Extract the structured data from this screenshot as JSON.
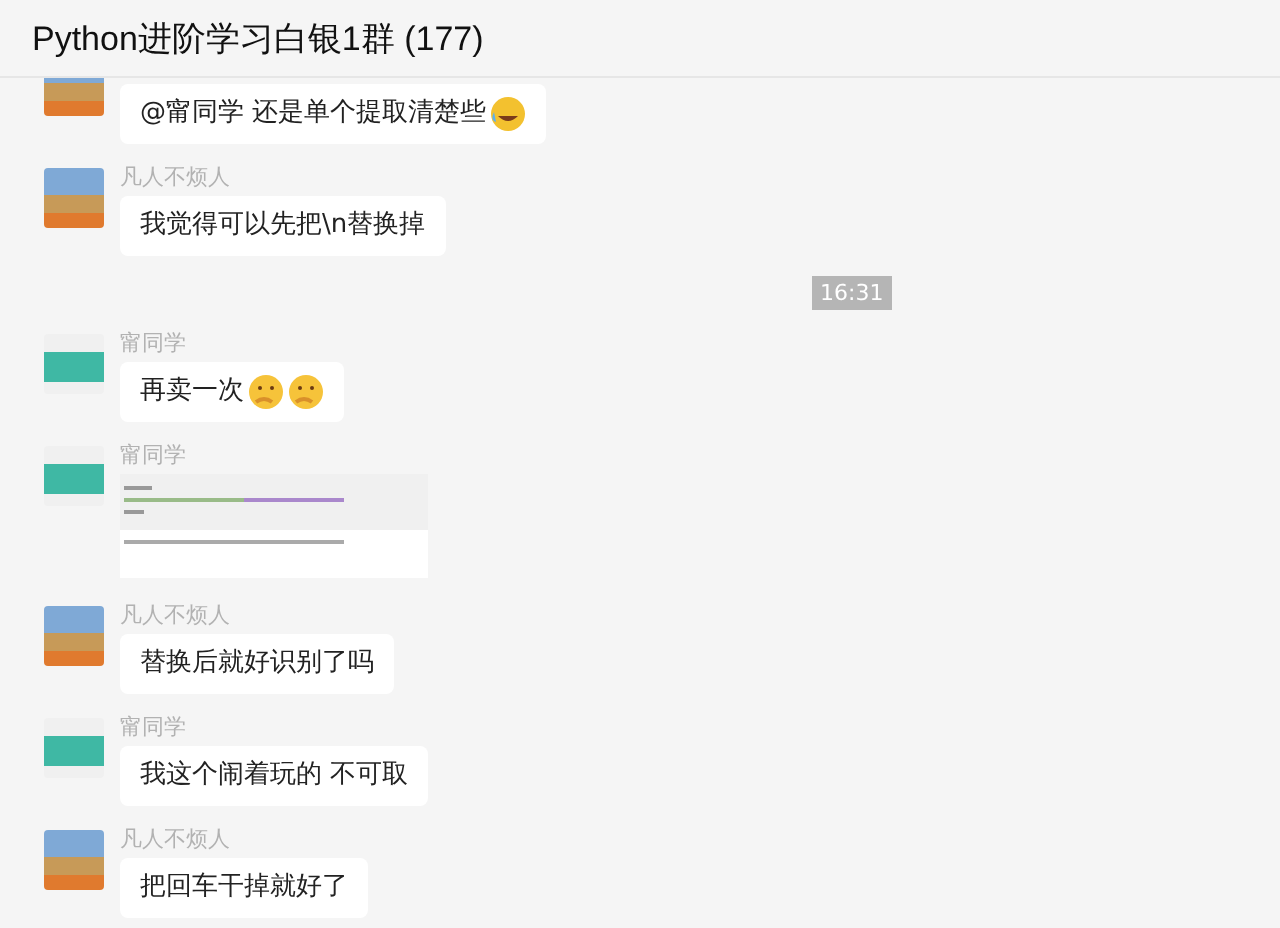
{
  "window": {
    "title": "Python进阶学习白银1群 (177)"
  },
  "messages": [
    {
      "kind": "text",
      "avatar": {
        "kind": "dog"
      },
      "text": "@甯同学 还是单个提取清楚些",
      "emojis": [
        {
          "kind": "laugh-cry"
        }
      ]
    },
    {
      "kind": "text",
      "sender": "凡人不烦人",
      "avatar": {
        "kind": "dog"
      },
      "text": "我觉得可以先把\\n替换掉"
    },
    {
      "kind": "time",
      "text": "16:31"
    },
    {
      "kind": "text",
      "sender": "甯同学",
      "avatar": {
        "kind": "shoe"
      },
      "text": "再卖一次",
      "emojis": [
        {
          "kind": "thinking"
        },
        {
          "kind": "thinking"
        }
      ]
    },
    {
      "kind": "image",
      "sender": "甯同学",
      "avatar": {
        "kind": "shoe"
      }
    },
    {
      "kind": "text",
      "sender": "凡人不烦人",
      "avatar": {
        "kind": "dog"
      },
      "text": "替换后就好识别了吗"
    },
    {
      "kind": "text",
      "sender": "甯同学",
      "avatar": {
        "kind": "shoe"
      },
      "text": "我这个闹着玩的 不可取"
    },
    {
      "kind": "text",
      "sender": "凡人不烦人",
      "avatar": {
        "kind": "dog"
      },
      "text": "把回车干掉就好了"
    }
  ]
}
